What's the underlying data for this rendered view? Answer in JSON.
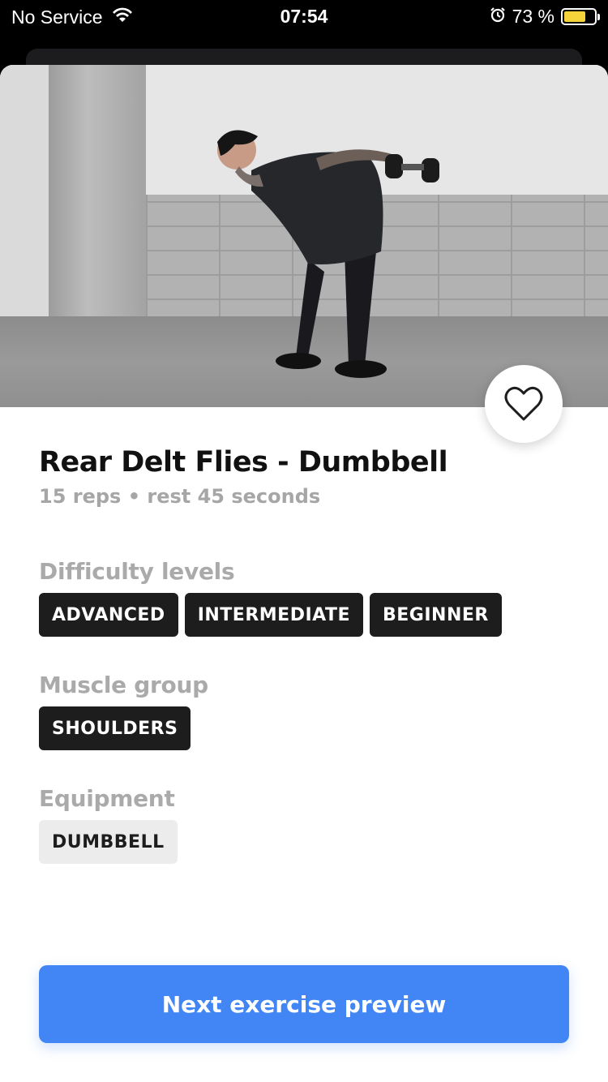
{
  "status_bar": {
    "carrier": "No Service",
    "time": "07:54",
    "battery_percent": "73 %",
    "battery_level": 0.73,
    "battery_color": "#f5d33b"
  },
  "exercise": {
    "title": "Rear Delt Flies - Dumbbell",
    "subtitle": "15 reps • rest 45 seconds"
  },
  "sections": {
    "difficulty": {
      "label": "Difficulty levels",
      "chips": [
        "ADVANCED",
        "INTERMEDIATE",
        "BEGINNER"
      ]
    },
    "muscle_group": {
      "label": "Muscle group",
      "chips": [
        "SHOULDERS"
      ]
    },
    "equipment": {
      "label": "Equipment",
      "chips": [
        "DUMBBELL"
      ]
    }
  },
  "actions": {
    "favorite_icon": "heart-outline-icon",
    "next_label": "Next exercise preview"
  },
  "colors": {
    "accent": "#4286f5",
    "chip_dark": "#1d1d1d",
    "chip_light": "#ececec"
  }
}
